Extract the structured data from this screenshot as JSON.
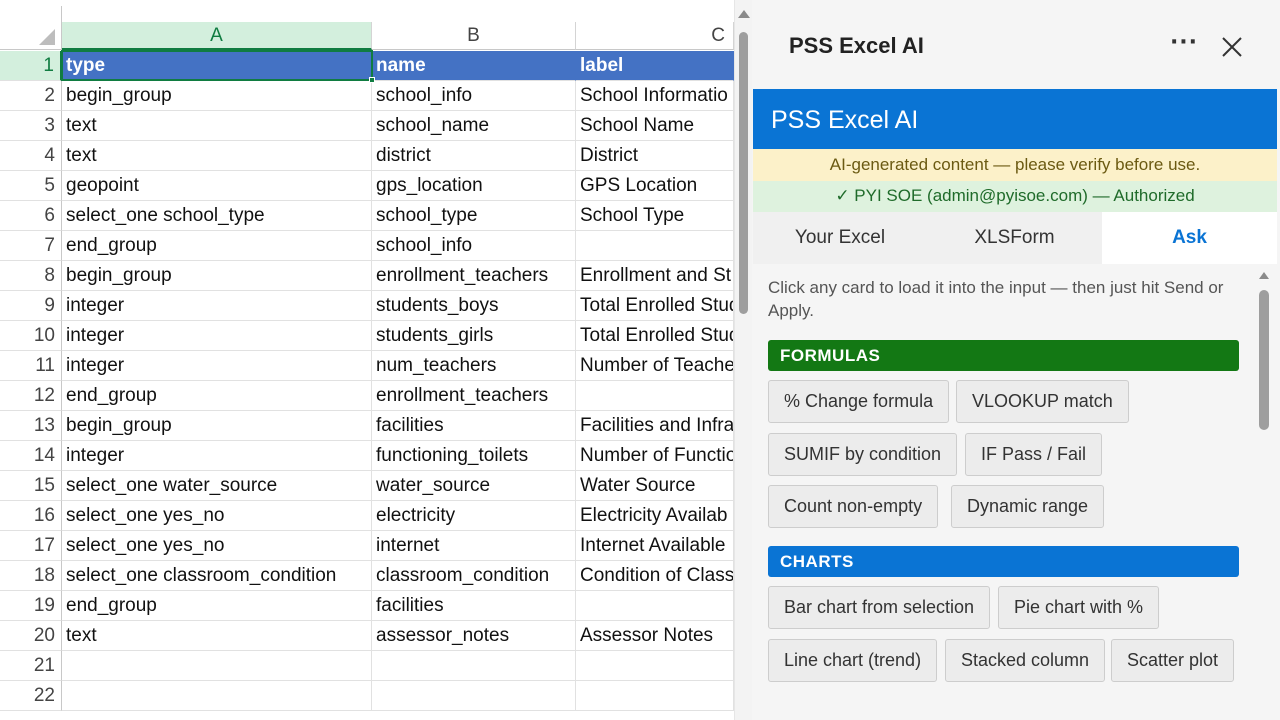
{
  "sheet": {
    "columns": [
      "A",
      "B",
      "C"
    ],
    "row_numbers": [
      "1",
      "2",
      "3",
      "4",
      "5",
      "6",
      "7",
      "8",
      "9",
      "10",
      "11",
      "12",
      "13",
      "14",
      "15",
      "16",
      "17",
      "18",
      "19",
      "20",
      "21",
      "22"
    ],
    "header_row": [
      "type",
      "name",
      "label"
    ],
    "rows": [
      [
        "begin_group",
        "school_info",
        "School Informatio"
      ],
      [
        "text",
        "school_name",
        "School Name"
      ],
      [
        "text",
        "district",
        "District"
      ],
      [
        "geopoint",
        "gps_location",
        "GPS Location"
      ],
      [
        "select_one school_type",
        "school_type",
        "School Type"
      ],
      [
        "end_group",
        "school_info",
        ""
      ],
      [
        "begin_group",
        "enrollment_teachers",
        "Enrollment and St"
      ],
      [
        "integer",
        "students_boys",
        "Total Enrolled Stud"
      ],
      [
        "integer",
        "students_girls",
        "Total Enrolled Stud"
      ],
      [
        "integer",
        "num_teachers",
        "Number of Teache"
      ],
      [
        "end_group",
        "enrollment_teachers",
        ""
      ],
      [
        "begin_group",
        "facilities",
        "Facilities and Infra"
      ],
      [
        "integer",
        "functioning_toilets",
        "Number of Functio"
      ],
      [
        "select_one water_source",
        "water_source",
        "Water Source"
      ],
      [
        "select_one yes_no",
        "electricity",
        "Electricity Availab"
      ],
      [
        "select_one yes_no",
        "internet",
        "Internet Available"
      ],
      [
        "select_one classroom_condition",
        "classroom_condition",
        "Condition of Class"
      ],
      [
        "end_group",
        "facilities",
        ""
      ],
      [
        "text",
        "assessor_notes",
        "Assessor Notes"
      ],
      [
        "",
        "",
        ""
      ],
      [
        "",
        "",
        ""
      ]
    ],
    "header_color": "#4472c4",
    "selection_color": "#107c41"
  },
  "pane": {
    "title": "PSS Excel AI",
    "more_label": "···",
    "banner_title": "PSS Excel AI",
    "ai_notice": "AI-generated content — please verify before use.",
    "auth_status": "✓ PYI SOE (admin@pyisoe.com) — Authorized",
    "tabs": [
      "Your Excel",
      "XLSForm",
      "Ask"
    ],
    "active_tab": "Ask",
    "hint": "Click any card to load it into the input — then just hit Send or Apply.",
    "sections": [
      {
        "title": "FORMULAS",
        "color": "#137814",
        "cards": [
          "% Change formula",
          "VLOOKUP match",
          "SUMIF by condition",
          "IF Pass / Fail",
          "Count non-empty",
          "Dynamic range"
        ]
      },
      {
        "title": "CHARTS",
        "color": "#0a74d4",
        "cards": [
          "Bar chart from selection",
          "Pie chart with %",
          "Line chart (trend)",
          "Stacked column",
          "Scatter plot"
        ]
      }
    ],
    "brand_color": "#0a74d4"
  }
}
